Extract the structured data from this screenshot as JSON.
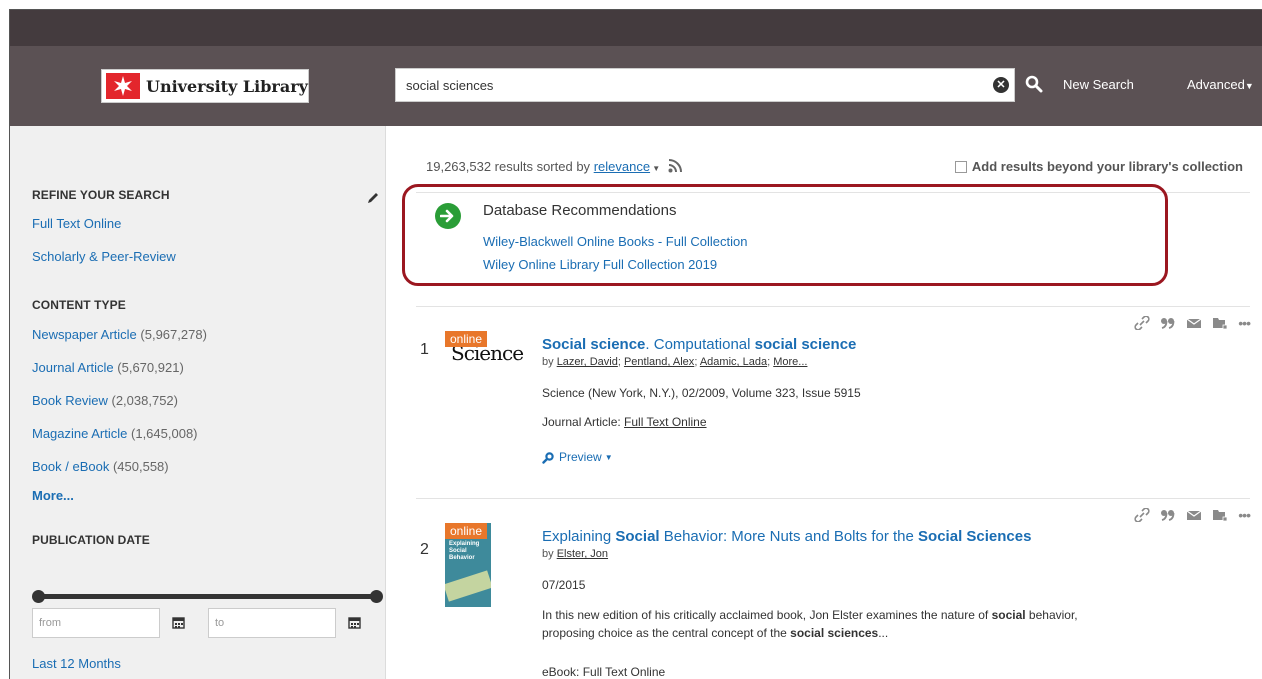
{
  "header": {
    "logo_text": "University Library",
    "search_value": "social sciences",
    "search_placeholder": "",
    "clear_symbol": "✕",
    "new_search": "New Search",
    "advanced": "Advanced"
  },
  "sidebar": {
    "refine_heading": "REFINE YOUR SEARCH",
    "refine_links": [
      "Full Text Online",
      "Scholarly & Peer-Review"
    ],
    "content_type_heading": "CONTENT TYPE",
    "content_types": [
      {
        "label": "Newspaper Article",
        "count": "(5,967,278)"
      },
      {
        "label": "Journal Article",
        "count": "(5,670,921)"
      },
      {
        "label": "Book Review",
        "count": "(2,038,752)"
      },
      {
        "label": "Magazine Article",
        "count": "(1,645,008)"
      },
      {
        "label": "Book / eBook",
        "count": "(450,558)"
      }
    ],
    "more": "More...",
    "pub_date_heading": "PUBLICATION DATE",
    "from_placeholder": "from",
    "to_placeholder": "to",
    "last_12_months": "Last 12 Months"
  },
  "results": {
    "count_text": "19,263,532 results sorted by",
    "sort": "relevance",
    "add_beyond": "Add results beyond your library's collection"
  },
  "db_recommendations": {
    "title": "Database Recommendations",
    "links": [
      "Wiley-Blackwell Online Books - Full Collection",
      "Wiley Online Library Full Collection 2019"
    ]
  },
  "result_items": [
    {
      "number": "1",
      "badge": "online",
      "thumb_text": "Science",
      "title_parts": [
        "Social science",
        ". Computational ",
        "social science"
      ],
      "by": "by",
      "authors": [
        "Lazer, David",
        "Pentland, Alex",
        "Adamic, Lada",
        "More..."
      ],
      "source": "Science (New York, N.Y.), 02/2009, Volume 323, Issue 5915",
      "type_label": "Journal Article:",
      "fulltext": "Full Text Online",
      "preview": "Preview"
    },
    {
      "number": "2",
      "badge": "online",
      "thumb_text": "Explaining Social Behavior",
      "title_parts": [
        "Explaining ",
        "Social",
        " Behavior: More Nuts and Bolts for the ",
        "Social Sciences"
      ],
      "by": "by",
      "authors": [
        "Elster, Jon"
      ],
      "date": "07/2015",
      "abstract_parts": [
        "In this new edition of his critically acclaimed book, Jon Elster examines the nature of ",
        "social",
        " behavior, proposing choice as the central concept of the ",
        "social sciences",
        "..."
      ],
      "type_label": "eBook:",
      "fulltext": "Full Text Online"
    }
  ],
  "colors": {
    "topbar": "#443b3e",
    "header": "#5b5154",
    "link": "#1a6db3",
    "highlight_border": "#9b1720",
    "badge": "#e8772b",
    "rec_icon": "#2a9d37"
  },
  "icons": {
    "search": "search-icon",
    "clear": "clear-icon",
    "rss": "rss-icon",
    "pencil": "pencil-icon",
    "calendar": "calendar-icon",
    "link": "link-icon",
    "cite": "quote-icon",
    "email": "email-icon",
    "folder": "folder-icon",
    "more": "more-icon"
  }
}
